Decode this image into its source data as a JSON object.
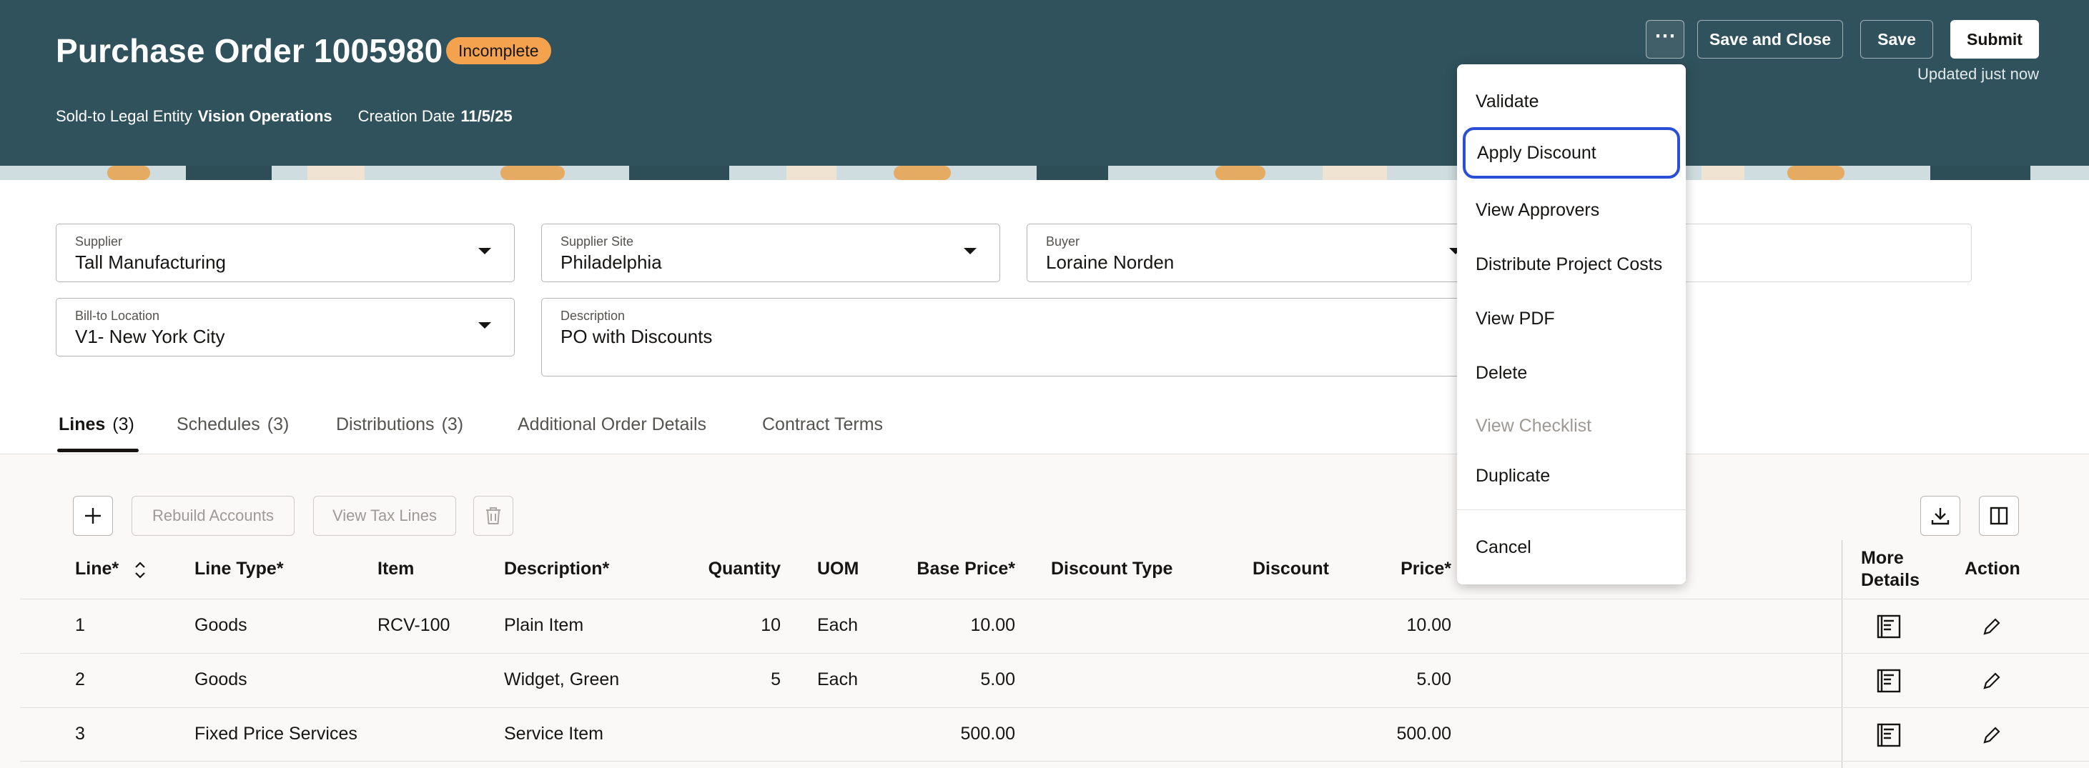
{
  "header": {
    "title": "Purchase Order 1005980",
    "status_badge": "Incomplete",
    "sold_to_label": "Sold-to Legal Entity",
    "sold_to_value": "Vision Operations",
    "creation_label": "Creation Date",
    "creation_value": "11/5/25",
    "more_icon": "ellipsis-icon",
    "save_and_close_label": "Save and Close",
    "save_label": "Save",
    "submit_label": "Submit",
    "updated_text": "Updated just now"
  },
  "colors": {
    "header_bg": "#30525c",
    "badge_bg": "#f4a24e",
    "focus_ring": "#2a4fd6"
  },
  "form": {
    "supplier": {
      "label": "Supplier",
      "value": "Tall Manufacturing"
    },
    "supplier_site": {
      "label": "Supplier Site",
      "value": "Philadelphia"
    },
    "buyer": {
      "label": "Buyer",
      "value": "Loraine Norden"
    },
    "bill_to": {
      "label": "Bill-to Location",
      "value": "V1- New York City"
    },
    "description": {
      "label": "Description",
      "value": "PO with Discounts"
    }
  },
  "tabs": [
    {
      "label": "Lines",
      "count": "(3)"
    },
    {
      "label": "Schedules",
      "count": "(3)"
    },
    {
      "label": "Distributions",
      "count": "(3)"
    },
    {
      "label": "Additional Order Details",
      "count": ""
    },
    {
      "label": "Contract Terms",
      "count": ""
    }
  ],
  "toolbar": {
    "add_icon": "plus-icon",
    "rebuild_accounts_label": "Rebuild Accounts",
    "view_tax_lines_label": "View Tax Lines",
    "delete_icon": "trash-icon",
    "download_icon": "download-icon",
    "columns_icon": "columns-icon"
  },
  "table": {
    "columns": [
      "Line*",
      "Line Type*",
      "Item",
      "Description*",
      "Quantity",
      "UOM",
      "Base Price*",
      "Discount Type",
      "Discount",
      "Price*",
      "More Details",
      "Action"
    ],
    "rows": [
      {
        "line": "1",
        "type": "Goods",
        "item": "RCV-100",
        "desc": "Plain Item",
        "qty": "10",
        "uom": "Each",
        "base": "10.00",
        "dtype": "",
        "discount": "",
        "price": "10.00"
      },
      {
        "line": "2",
        "type": "Goods",
        "item": "",
        "desc": "Widget, Green",
        "qty": "5",
        "uom": "Each",
        "base": "5.00",
        "dtype": "",
        "discount": "",
        "price": "5.00"
      },
      {
        "line": "3",
        "type": "Fixed Price Services",
        "item": "",
        "desc": "Service Item",
        "qty": "",
        "uom": "",
        "base": "500.00",
        "dtype": "",
        "discount": "",
        "price": "500.00"
      }
    ]
  },
  "menu": {
    "items": [
      "Validate",
      "Apply Discount",
      "View Approvers",
      "Distribute Project Costs",
      "View PDF",
      "Delete",
      "View Checklist",
      "Duplicate"
    ],
    "cancel": "Cancel"
  }
}
